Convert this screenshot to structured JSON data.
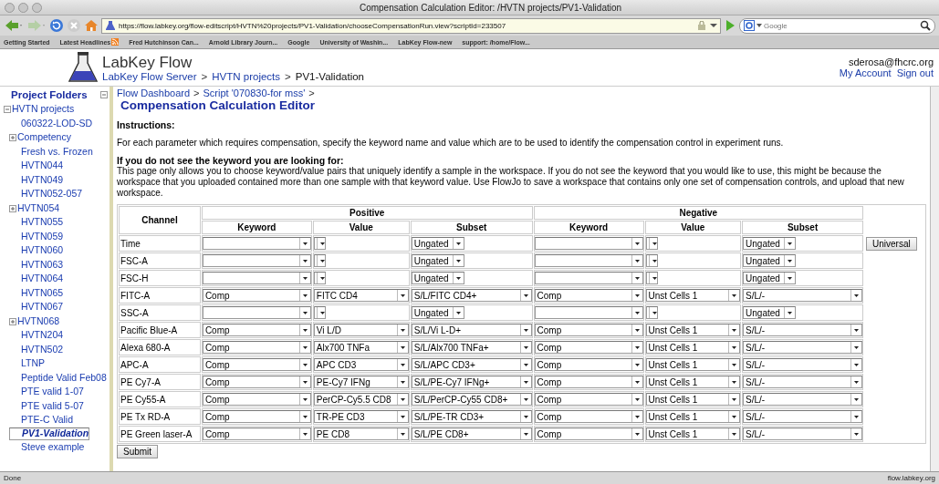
{
  "browser": {
    "title": "Compensation Calculation Editor: /HVTN projects/PV1-Validation",
    "url": "https://flow.labkey.org/flow-editscript/HVTN%20projects/PV1-Validation/chooseCompensationRun.view?scriptId=233507",
    "search_placeholder": "Google",
    "bookmarks": [
      {
        "label": "Getting Started",
        "kind": "link"
      },
      {
        "label": "Latest Headlines",
        "kind": "feed"
      },
      {
        "label": "Fred Hutchinson Can...",
        "kind": "link"
      },
      {
        "label": "Arnold Library Journ...",
        "kind": "link"
      },
      {
        "label": "Google",
        "kind": "link"
      },
      {
        "label": "University of Washin...",
        "kind": "link"
      },
      {
        "label": "LabKey Flow-new",
        "kind": "link"
      },
      {
        "label": "support: /home/Flow...",
        "kind": "link"
      }
    ]
  },
  "header": {
    "app_name": "LabKey Flow",
    "breadcrumbs": [
      "LabKey Flow Server",
      "HVTN projects",
      "PV1-Validation"
    ],
    "separator": ">",
    "user": "sderosa@fhcrc.org",
    "links": [
      "My Account",
      "Sign out"
    ]
  },
  "sidebar": {
    "title": "Project Folders",
    "expanded": true,
    "tree": [
      {
        "label": "HVTN projects",
        "expanded": true,
        "selected": false,
        "children": [
          {
            "label": "060322-LOD-SD",
            "selected": false
          },
          {
            "label": "Competency",
            "expanded": false,
            "selected": false
          },
          {
            "label": "Fresh vs. Frozen",
            "selected": false
          },
          {
            "label": "HVTN044",
            "selected": false
          },
          {
            "label": "HVTN049",
            "selected": false
          },
          {
            "label": "HVTN052-057",
            "selected": false
          },
          {
            "label": "HVTN054",
            "expanded": false,
            "selected": false
          },
          {
            "label": "HVTN055",
            "selected": false
          },
          {
            "label": "HVTN059",
            "selected": false
          },
          {
            "label": "HVTN060",
            "selected": false
          },
          {
            "label": "HVTN063",
            "selected": false
          },
          {
            "label": "HVTN064",
            "selected": false
          },
          {
            "label": "HVTN065",
            "selected": false
          },
          {
            "label": "HVTN067",
            "selected": false
          },
          {
            "label": "HVTN068",
            "expanded": false,
            "selected": false
          },
          {
            "label": "HVTN204",
            "selected": false
          },
          {
            "label": "HVTN502",
            "selected": false
          },
          {
            "label": "LTNP",
            "selected": false
          },
          {
            "label": "Peptide Valid Feb08",
            "selected": false
          },
          {
            "label": "PTE valid 1-07",
            "selected": false
          },
          {
            "label": "PTE valid 5-07",
            "selected": false
          },
          {
            "label": "PTE-C Valid",
            "selected": false
          },
          {
            "label": "PV1-Validation",
            "selected": true
          },
          {
            "label": "Steve example",
            "selected": false
          }
        ]
      }
    ]
  },
  "content": {
    "breadcrumbs": [
      "Flow Dashboard",
      "Script '070830-for mss'"
    ],
    "separator": ">",
    "title": "Compensation Calculation Editor",
    "sections": [
      {
        "heading": "Instructions:",
        "text": "For each parameter which requires compensation, specify the keyword name and value which are to be used to identify the compensation control in experiment runs."
      },
      {
        "heading": "If you do not see the keyword you are looking for:",
        "text": "This page only allows you to choose keyword/value pairs that uniquely identify a sample in the workspace. If you do not see the keyword that you would like to use, this might be because the workspace that you uploaded contained more than one sample with that keyword value. Use FlowJo to save a workspace that contains only one set of compensation controls, and upload that new workspace."
      }
    ]
  },
  "table": {
    "channel_header": "Channel",
    "groups": [
      {
        "label": "Positive",
        "columns": [
          "Keyword",
          "Value",
          "Subset"
        ]
      },
      {
        "label": "Negative",
        "columns": [
          "Keyword",
          "Value",
          "Subset"
        ]
      }
    ],
    "rows": [
      {
        "channel": "Time",
        "kind": "unset",
        "positive": {
          "subset": "Ungated"
        },
        "negative": {
          "subset": "Ungated"
        },
        "action": "Universal"
      },
      {
        "channel": "FSC-A",
        "kind": "unset",
        "positive": {
          "subset": "Ungated"
        },
        "negative": {
          "subset": "Ungated"
        }
      },
      {
        "channel": "FSC-H",
        "kind": "unset",
        "positive": {
          "subset": "Ungated"
        },
        "negative": {
          "subset": "Ungated"
        }
      },
      {
        "channel": "FITC-A",
        "kind": "set",
        "positive": {
          "keyword": "Comp",
          "value": "FITC CD4",
          "subset": "S/L/FITC CD4+"
        },
        "negative": {
          "keyword": "Comp",
          "value": "Unst Cells 1",
          "subset": "S/L/-"
        }
      },
      {
        "channel": "SSC-A",
        "kind": "unset",
        "positive": {
          "subset": "Ungated"
        },
        "negative": {
          "subset": "Ungated"
        }
      },
      {
        "channel": "Pacific Blue-A",
        "kind": "set",
        "positive": {
          "keyword": "Comp",
          "value": "Vi L/D",
          "subset": "S/L/Vi L-D+"
        },
        "negative": {
          "keyword": "Comp",
          "value": "Unst Cells 1",
          "subset": "S/L/-"
        }
      },
      {
        "channel": "Alexa 680-A",
        "kind": "set",
        "positive": {
          "keyword": "Comp",
          "value": "Alx700 TNFa",
          "subset": "S/L/Alx700 TNFa+"
        },
        "negative": {
          "keyword": "Comp",
          "value": "Unst Cells 1",
          "subset": "S/L/-"
        }
      },
      {
        "channel": "APC-A",
        "kind": "set",
        "positive": {
          "keyword": "Comp",
          "value": "APC CD3",
          "subset": "S/L/APC CD3+"
        },
        "negative": {
          "keyword": "Comp",
          "value": "Unst Cells 1",
          "subset": "S/L/-"
        }
      },
      {
        "channel": "PE Cy7-A",
        "kind": "set",
        "positive": {
          "keyword": "Comp",
          "value": "PE-Cy7 IFNg",
          "subset": "S/L/PE-Cy7 IFNg+"
        },
        "negative": {
          "keyword": "Comp",
          "value": "Unst Cells 1",
          "subset": "S/L/-"
        }
      },
      {
        "channel": "PE Cy55-A",
        "kind": "set",
        "positive": {
          "keyword": "Comp",
          "value": "PerCP-Cy5.5 CD8",
          "subset": "S/L/PerCP-Cy55 CD8+"
        },
        "negative": {
          "keyword": "Comp",
          "value": "Unst Cells 1",
          "subset": "S/L/-"
        }
      },
      {
        "channel": "PE Tx RD-A",
        "kind": "set",
        "positive": {
          "keyword": "Comp",
          "value": "TR-PE CD3",
          "subset": "S/L/PE-TR CD3+"
        },
        "negative": {
          "keyword": "Comp",
          "value": "Unst Cells 1",
          "subset": "S/L/-"
        }
      },
      {
        "channel": "PE Green laser-A",
        "kind": "set",
        "positive": {
          "keyword": "Comp",
          "value": "PE CD8",
          "subset": "S/L/PE CD8+"
        },
        "negative": {
          "keyword": "Comp",
          "value": "Unst Cells 1",
          "subset": "S/L/-"
        }
      }
    ]
  },
  "submit": "Submit",
  "status_bar": {
    "text": "Done",
    "host": "flow.labkey.org"
  }
}
